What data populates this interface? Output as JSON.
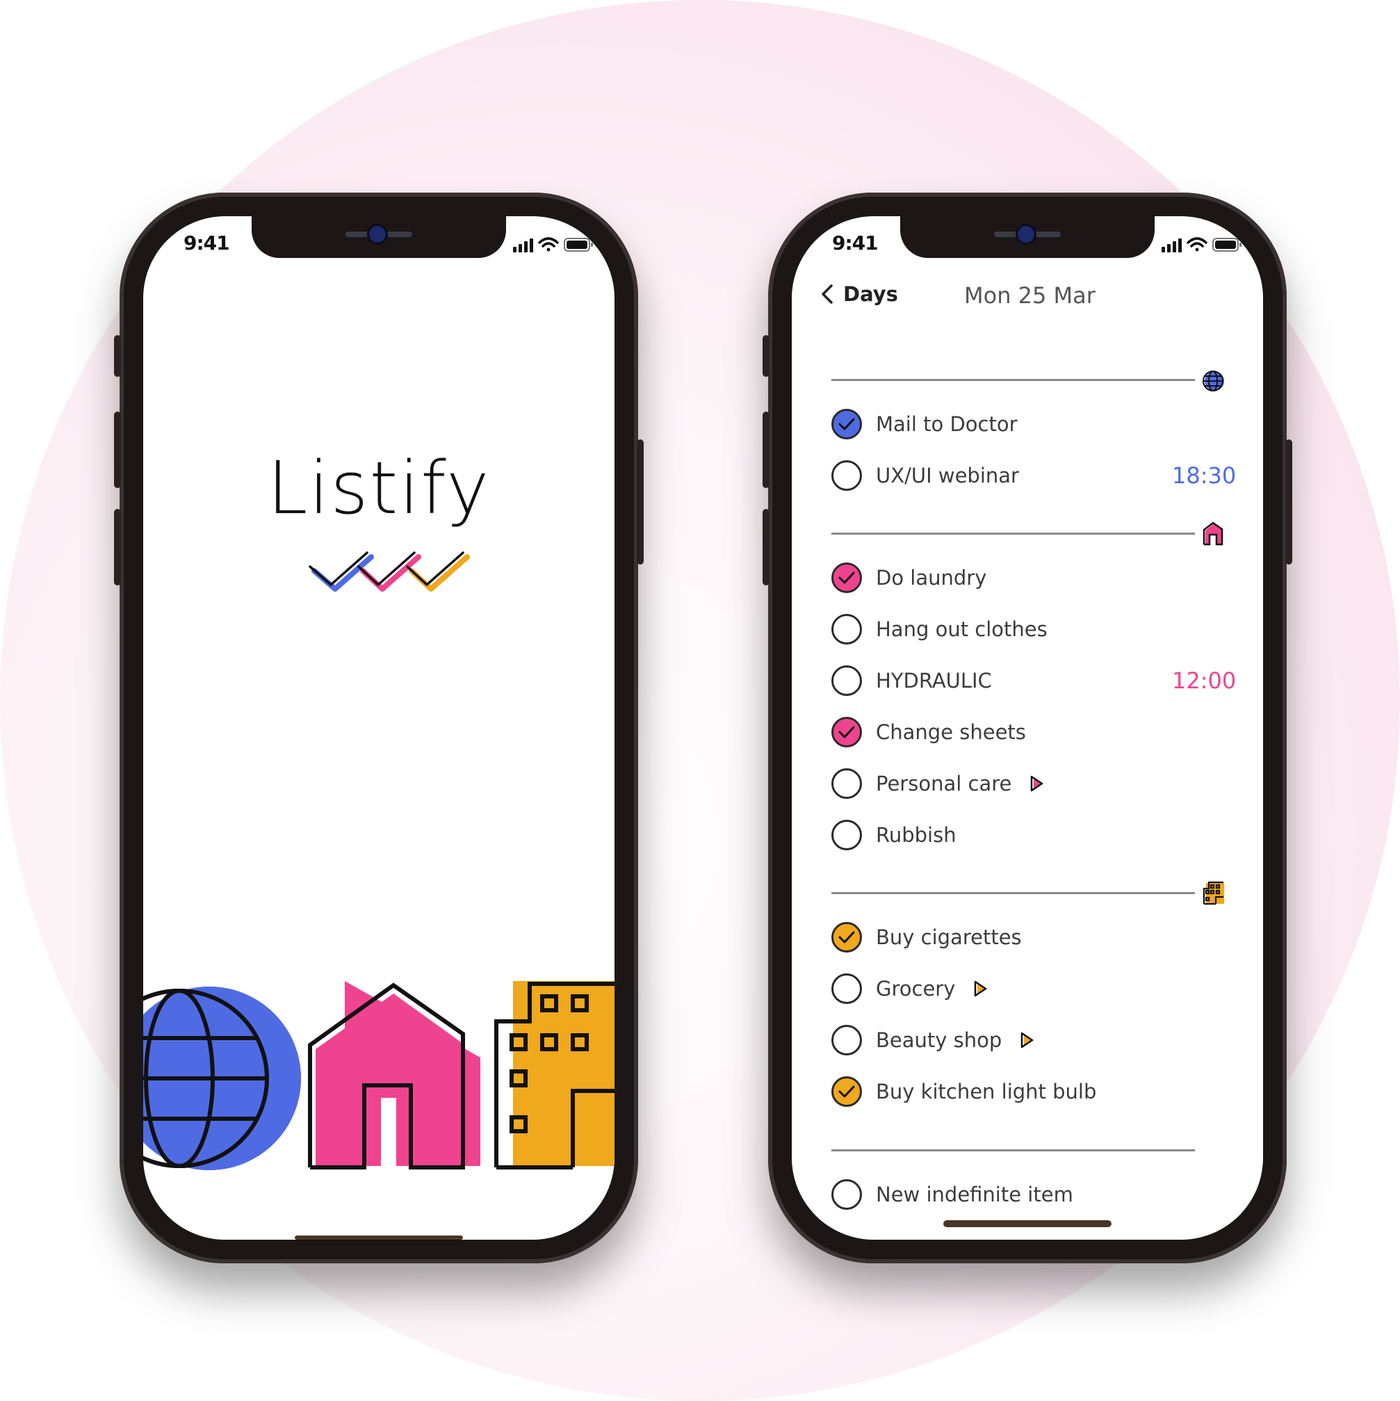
{
  "splash": {
    "status_time": "9:41",
    "app_name": "Listify"
  },
  "list_screen": {
    "status_time": "9:41",
    "back_label": "Days",
    "date": "Mon 25 Mar",
    "sections": [
      {
        "category_icon": "globe-icon",
        "color": "#4f6be3",
        "items": [
          {
            "label": "Mail to Doctor",
            "done": true
          },
          {
            "label": "UX/UI webinar",
            "done": false,
            "time": "18:30"
          }
        ]
      },
      {
        "category_icon": "house-icon",
        "color": "#f0438f",
        "items": [
          {
            "label": "Do laundry",
            "done": true
          },
          {
            "label": "Hang out clothes",
            "done": false
          },
          {
            "label": "HYDRAULIC",
            "done": false,
            "time": "12:00"
          },
          {
            "label": "Change sheets",
            "done": true
          },
          {
            "label": "Personal care",
            "done": false,
            "has_arrow": true
          },
          {
            "label": "Rubbish",
            "done": false
          }
        ]
      },
      {
        "category_icon": "building-icon",
        "color": "#f0a81c",
        "items": [
          {
            "label": "Buy cigarettes",
            "done": true
          },
          {
            "label": "Grocery",
            "done": false,
            "has_arrow": true
          },
          {
            "label": "Beauty shop",
            "done": false,
            "has_arrow": true
          },
          {
            "label": "Buy kitchen light bulb",
            "done": true
          }
        ]
      }
    ],
    "new_item_label": "New indefinite item"
  }
}
